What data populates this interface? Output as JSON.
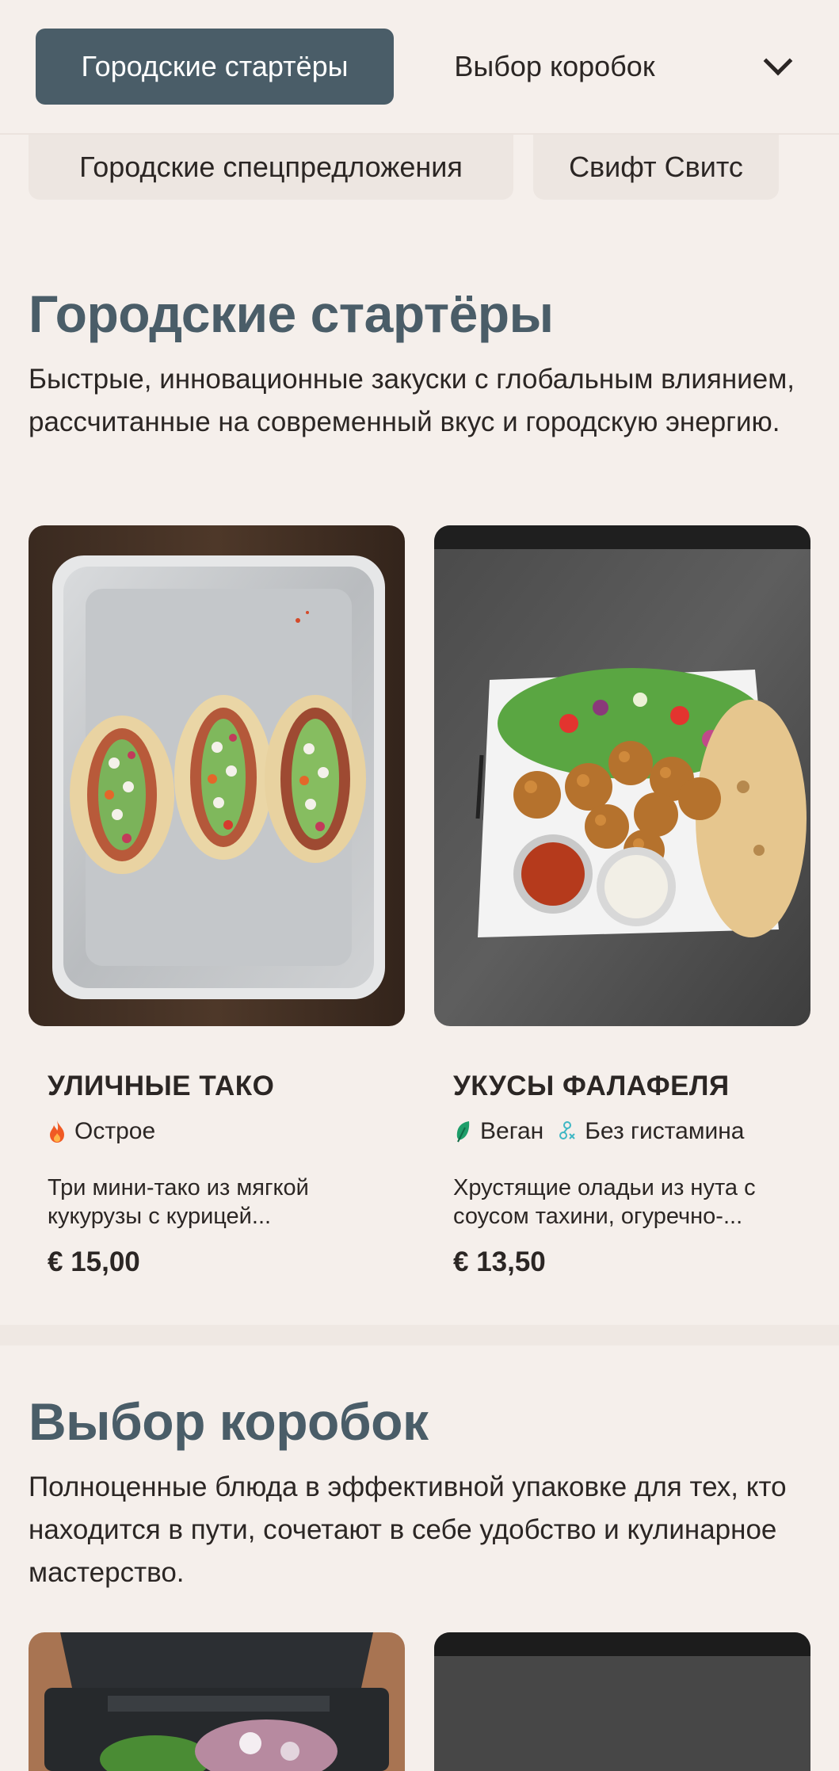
{
  "nav": {
    "active_category": "Городские стартёры",
    "categories": [
      "Выбор коробок",
      "Городские спецпредложения",
      "Свифт Свитс"
    ],
    "toggle_icon": "chevron-down-icon"
  },
  "sections": [
    {
      "title": "Городские стартёры",
      "description": "Быстрые, инновационные закуски с глобальным влиянием, рассчитанные на современный вкус и городскую энергию.",
      "products": [
        {
          "name": "УЛИЧНЫЕ ТАКО",
          "tags": [
            {
              "label": "Острое",
              "icon": "flame-icon",
              "color": "#f05a24"
            }
          ],
          "description": "Три мини-тако из мягкой\nкукурузы с курицей...",
          "price": "€ 15,00",
          "image": "tacos-on-metal-tray"
        },
        {
          "name": "УКУСЫ ФАЛАФЕЛЯ",
          "tags": [
            {
              "label": "Веган",
              "icon": "leaf-icon",
              "color": "#1e9e6a"
            },
            {
              "label": "Без гистамина",
              "icon": "histamine-free-icon",
              "color": "#3fb7c4"
            }
          ],
          "description": "Хрустящие оладьи из нута с\nсоусом тахини, огуречно-...",
          "price": "€ 13,50",
          "image": "falafel-plate"
        }
      ]
    },
    {
      "title": "Выбор коробок",
      "description": "Полноценные блюда в эффективной упаковке для тех, кто находится в пути, сочетают в себе удобство и кулинарное мастерство.",
      "products": [
        {
          "image": "salad-box"
        },
        {
          "image": "dark-box"
        }
      ]
    }
  ],
  "colors": {
    "background": "#f5efeb",
    "accent": "#4a5d68",
    "text": "#2b2624"
  }
}
